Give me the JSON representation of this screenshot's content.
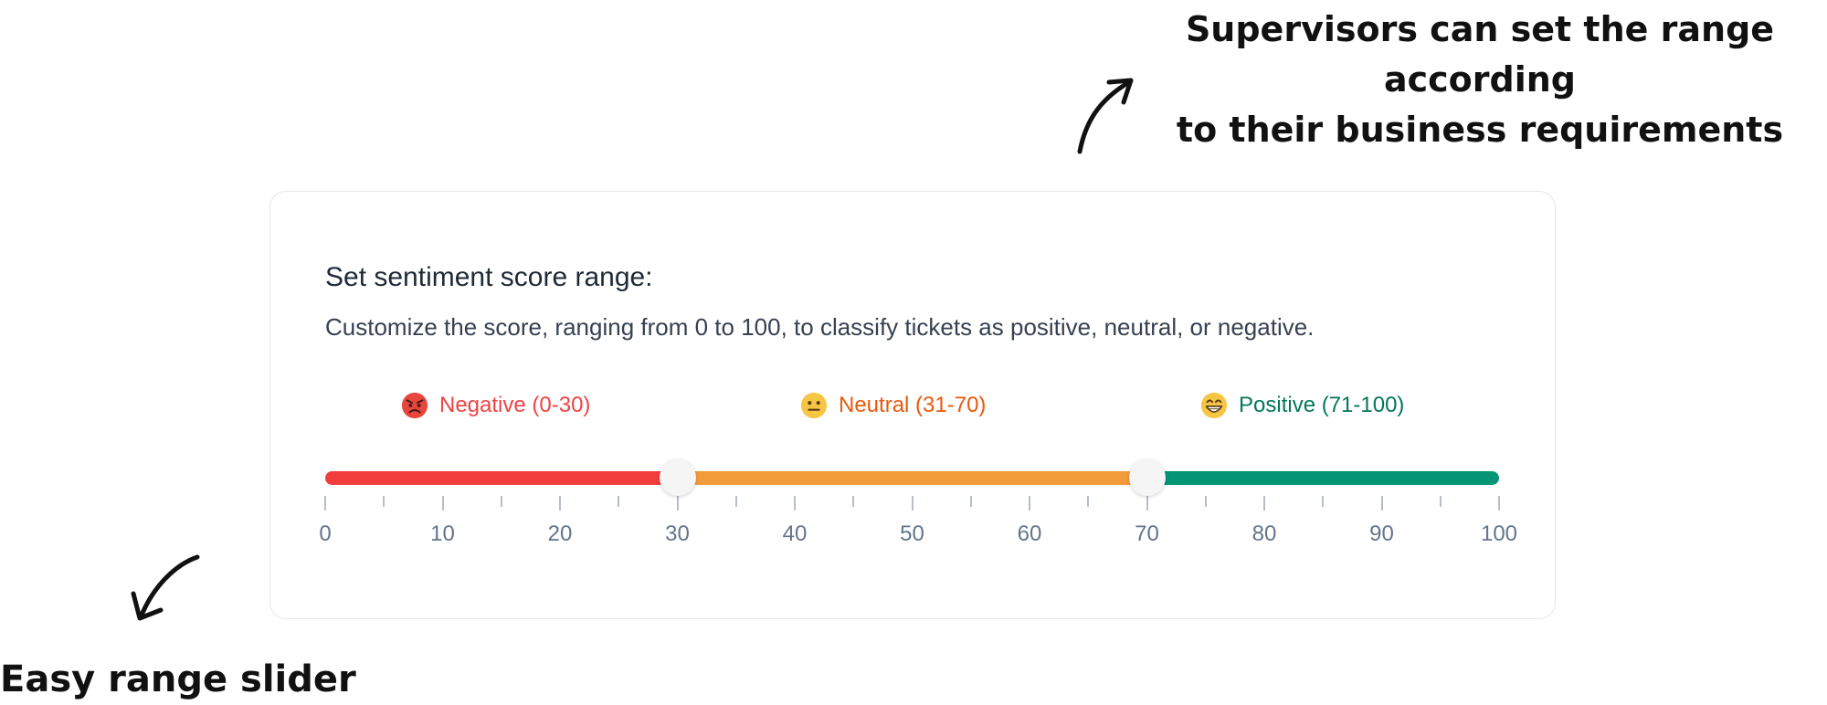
{
  "annotations": {
    "top_line1": "Supervisors can set the range according",
    "top_line2": "to their business requirements",
    "bottom": "Easy range slider"
  },
  "card": {
    "title": "Set sentiment score range:",
    "description": "Customize the score, ranging from 0 to 100, to classify tickets as positive, neutral, or negative."
  },
  "legend": [
    {
      "label": "Negative (0-30)",
      "icon": "angry-face-icon",
      "color": "#ef4444"
    },
    {
      "label": "Neutral (31-70)",
      "icon": "neutral-face-icon",
      "color": "#ea580c"
    },
    {
      "label": "Positive (71-100)",
      "icon": "grinning-face-icon",
      "color": "#047857"
    }
  ],
  "slider": {
    "min": 0,
    "max": 100,
    "values": [
      30,
      70
    ],
    "segment_colors": [
      "#f23d3d",
      "#f29b3a",
      "#059475"
    ],
    "tick_labels": [
      "0",
      "10",
      "20",
      "30",
      "40",
      "50",
      "60",
      "70",
      "80",
      "90",
      "100"
    ]
  }
}
